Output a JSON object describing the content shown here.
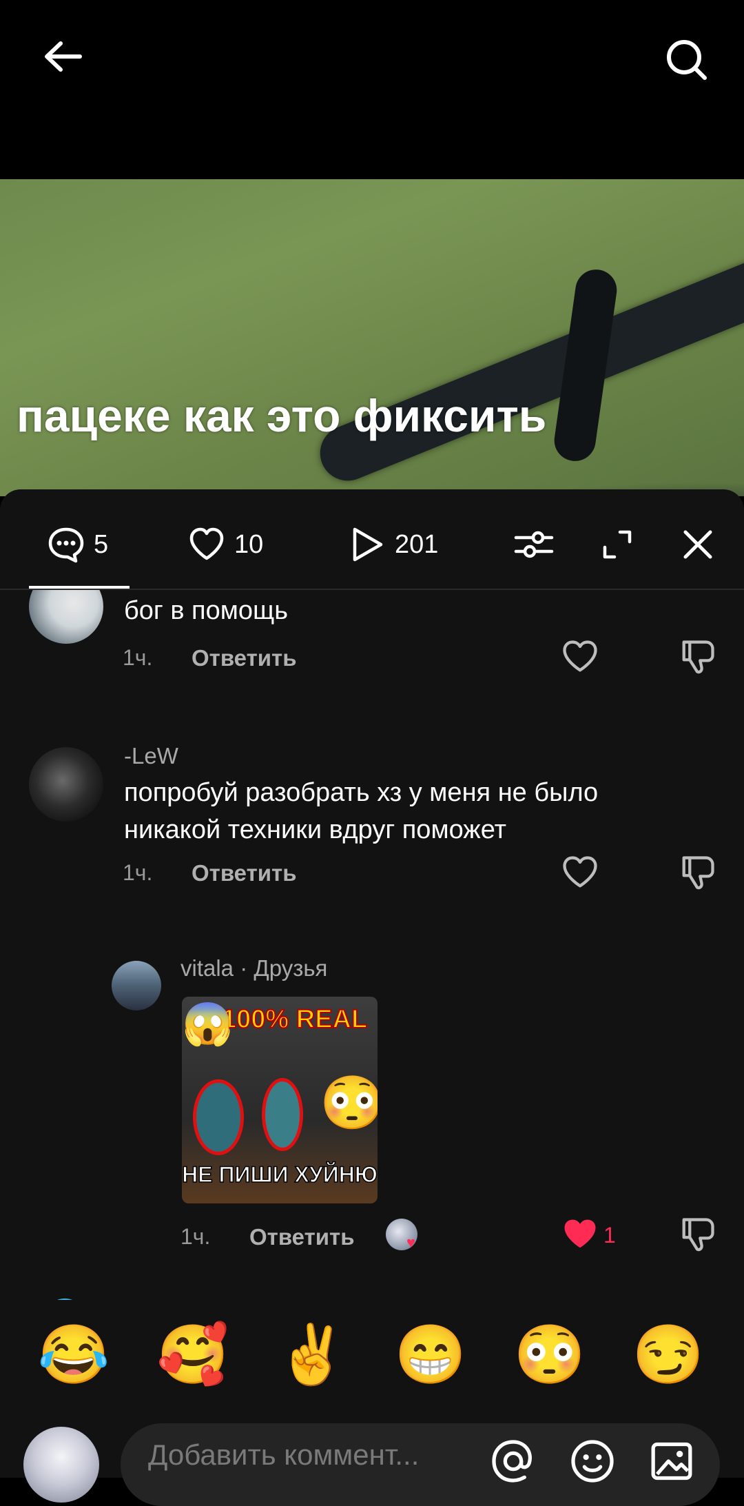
{
  "video": {
    "caption": "пацеке как это фиксить"
  },
  "tabs": {
    "comments_count": "5",
    "likes_count": "10",
    "views_count": "201"
  },
  "comments": [
    {
      "text": "бог в помощь",
      "time": "1ч.",
      "reply_label": "Ответить"
    },
    {
      "author": "-LeW",
      "text_line1": "попробуй разобрать хз у меня не было",
      "text_line2": "никакой техники вдруг поможет",
      "time": "1ч.",
      "reply_label": "Ответить"
    },
    {
      "author": "vitala",
      "author_suffix": " · Друзья",
      "sticker_top": "100% REAL",
      "sticker_bottom": "НЕ ПИШИ ХУЙНЮ",
      "time": "1ч.",
      "reply_label": "Ответить",
      "likes": "1"
    }
  ],
  "emojis": [
    "😂",
    "🥰",
    "✌️",
    "😁",
    "😳",
    "😏"
  ],
  "input": {
    "placeholder": "Добавить коммент..."
  },
  "colors": {
    "sheet_bg": "#121212",
    "like_active": "#fe2c55",
    "input_bg": "#242424"
  }
}
